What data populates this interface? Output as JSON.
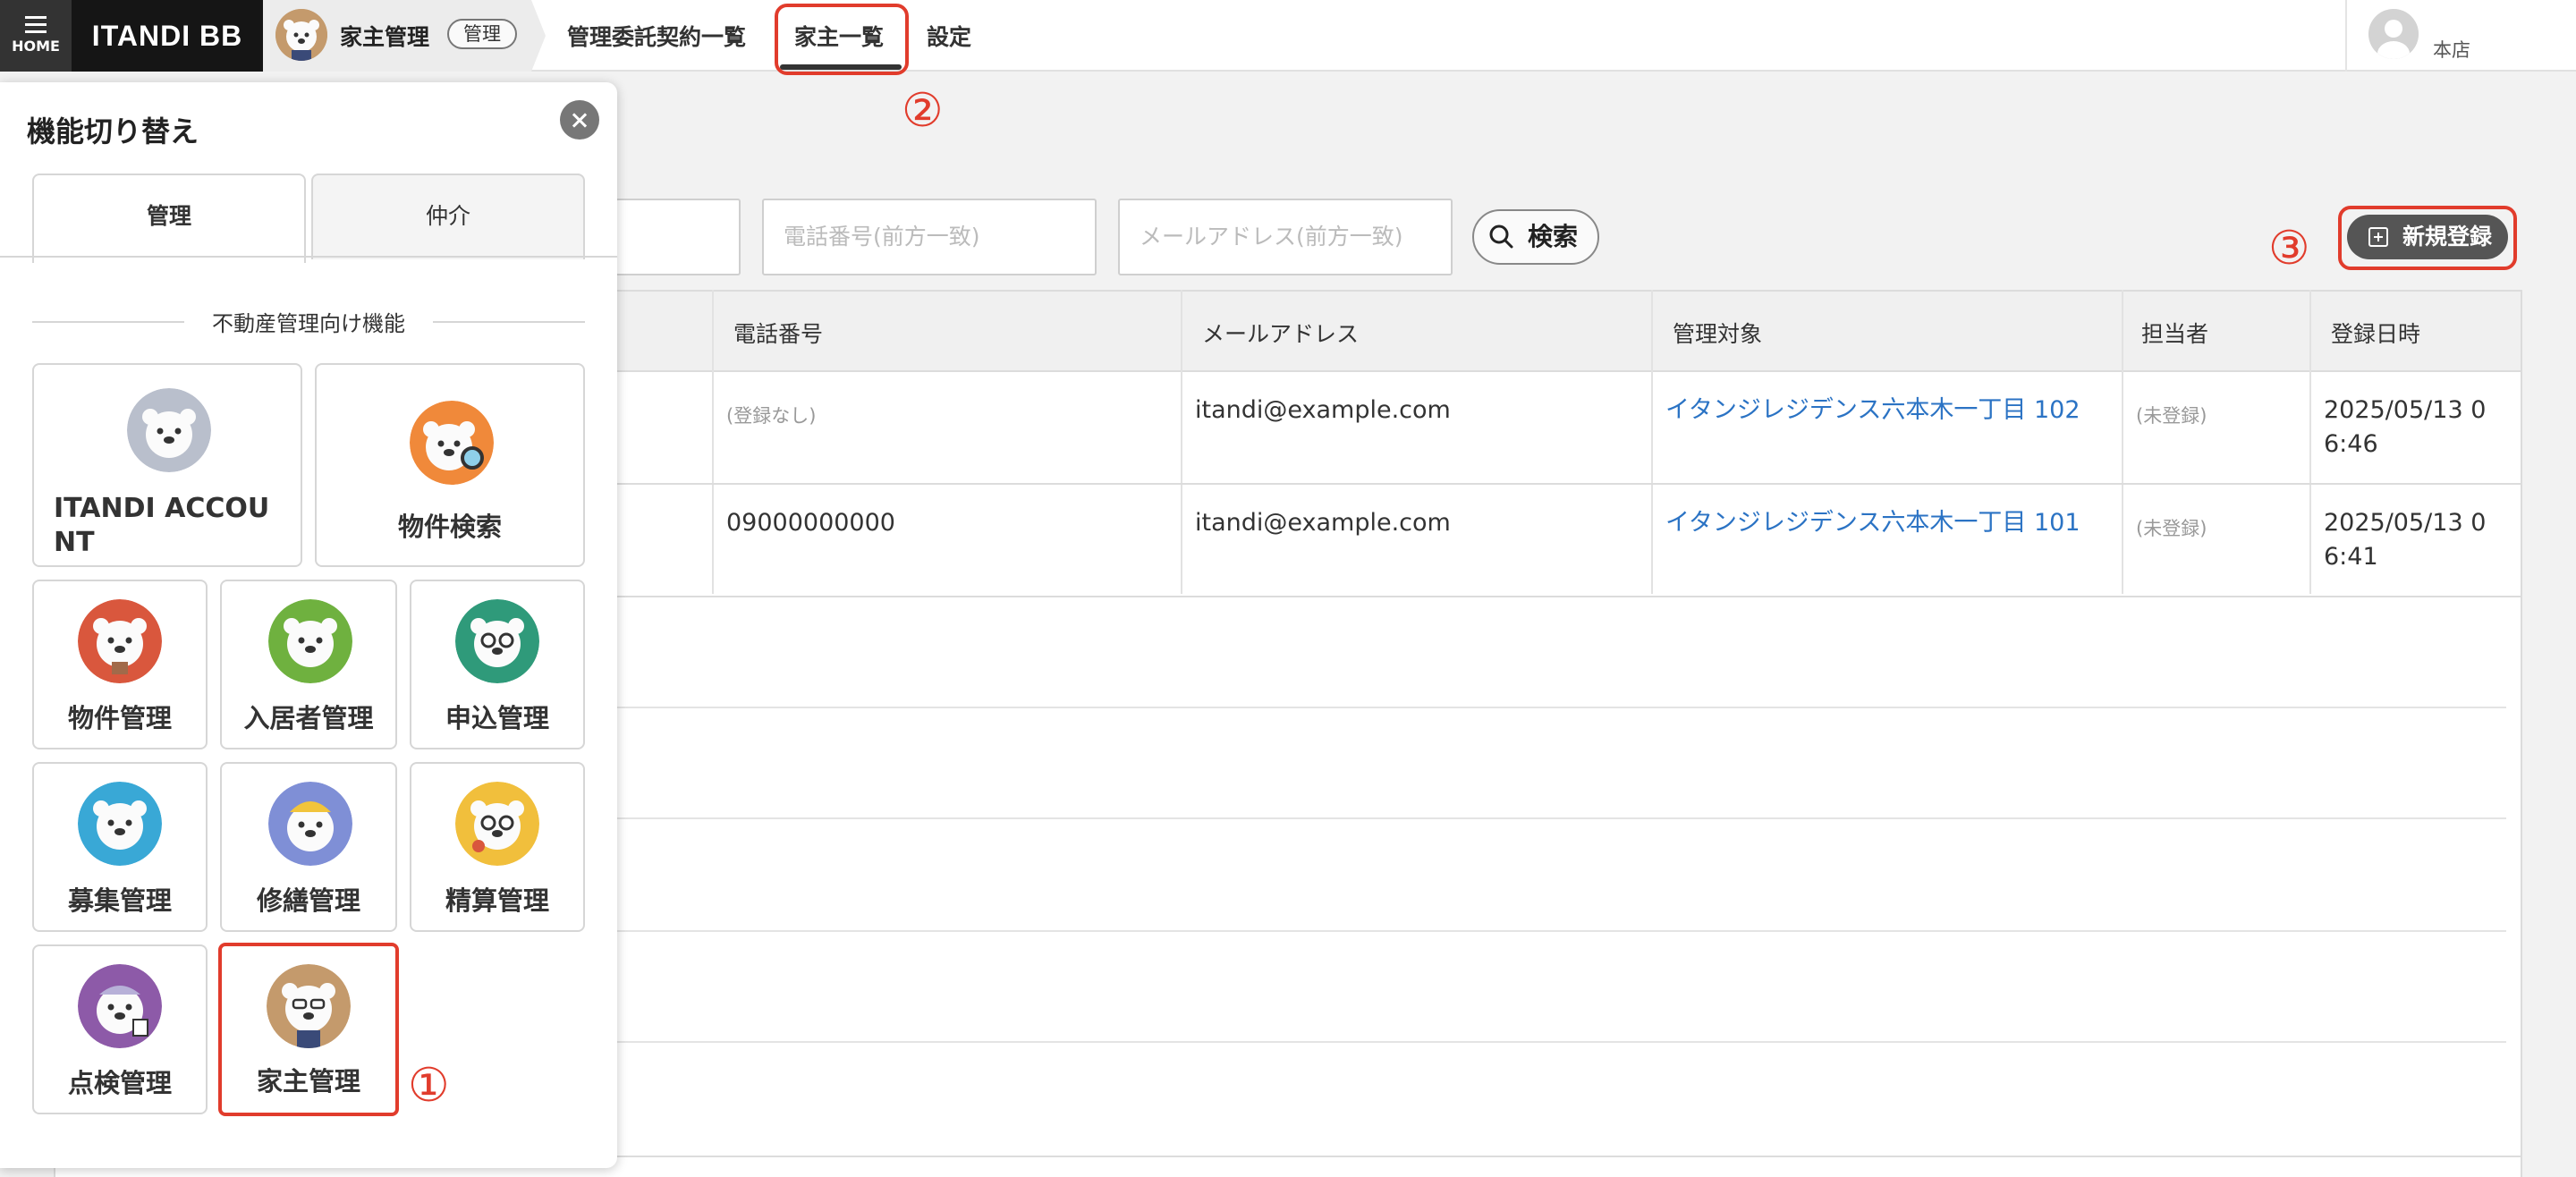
{
  "header": {
    "home_label": "HOME",
    "brand": "ITANDI BB",
    "crumb_title": "家主管理",
    "crumb_tag": "管理",
    "nav": [
      "管理委託契約一覧",
      "家主一覧",
      "設定"
    ],
    "active_nav": "家主一覧",
    "branch": "本店"
  },
  "search": {
    "phone_placeholder": "電話番号(前方一致)",
    "email_placeholder": "メールアドレス(前方一致)",
    "search_label": "検索",
    "new_label": "新規登録"
  },
  "table": {
    "headers": [
      "電話番号",
      "メールアドレス",
      "管理対象",
      "担当者",
      "登録日時"
    ],
    "rows": [
      {
        "phone": "(登録なし)",
        "email": "itandi@example.com",
        "target": "イタンジレジデンス六本木一丁目 102",
        "staff": "(未登録)",
        "date_line1": "2025/05/13 0",
        "date_line2": "6:46"
      },
      {
        "phone": "09000000000",
        "email": "itandi@example.com",
        "target": "イタンジレジデンス六本木一丁目 101",
        "staff": "(未登録)",
        "date_line1": "2025/05/13 0",
        "date_line2": "6:41"
      }
    ]
  },
  "panel": {
    "title": "機能切り替え",
    "tabs": [
      "管理",
      "仲介"
    ],
    "section": "不動産管理向け機能",
    "tiles_large": [
      {
        "label_line1": "ITANDI ACCOU",
        "label_line2": "NT",
        "color": "#b9bfcc"
      },
      {
        "label": "物件検索",
        "color": "#f0893a"
      }
    ],
    "tiles": [
      {
        "label": "物件管理",
        "color": "#d9573d"
      },
      {
        "label": "入居者管理",
        "color": "#6fb13f"
      },
      {
        "label": "申込管理",
        "color": "#2f9a7a"
      },
      {
        "label": "募集管理",
        "color": "#39a8d6"
      },
      {
        "label": "修繕管理",
        "color": "#7f8fd6"
      },
      {
        "label": "精算管理",
        "color": "#f1bf3c"
      },
      {
        "label": "点検管理",
        "color": "#8d5aa8"
      },
      {
        "label": "家主管理",
        "color": "#c49a6c"
      }
    ]
  },
  "annotations": {
    "one": "①",
    "two": "②",
    "three": "③"
  }
}
